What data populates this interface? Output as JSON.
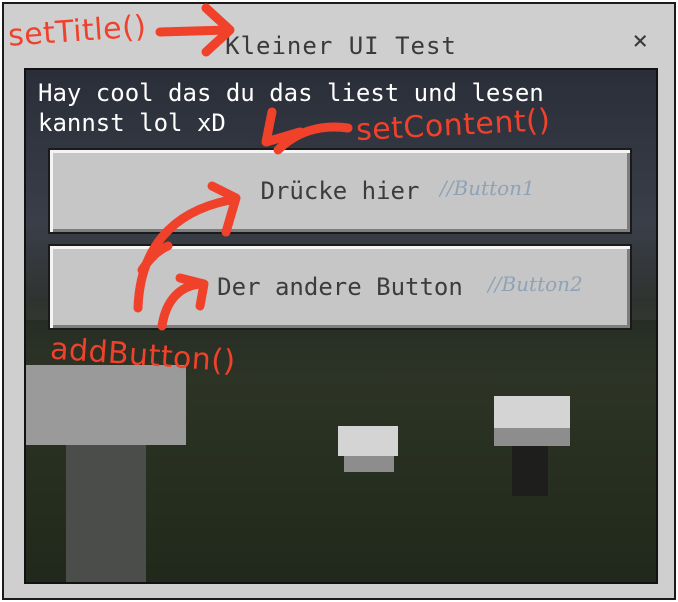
{
  "window": {
    "title": "Kleiner UI Test",
    "close_glyph": "×"
  },
  "form": {
    "content": "Hay cool das du das liest und lesen\nkannst lol xD",
    "buttons": [
      {
        "label": "Drücke hier",
        "comment": "//Button1"
      },
      {
        "label": "Der andere Button",
        "comment": "//Button2"
      }
    ]
  },
  "annotations": {
    "set_title": "setTitle()",
    "set_content": "setContent()",
    "add_button": "addButton()"
  },
  "colors": {
    "annotation": "#f0412b",
    "comment": "#8fa2b6",
    "panel": "#c6c6c6"
  }
}
